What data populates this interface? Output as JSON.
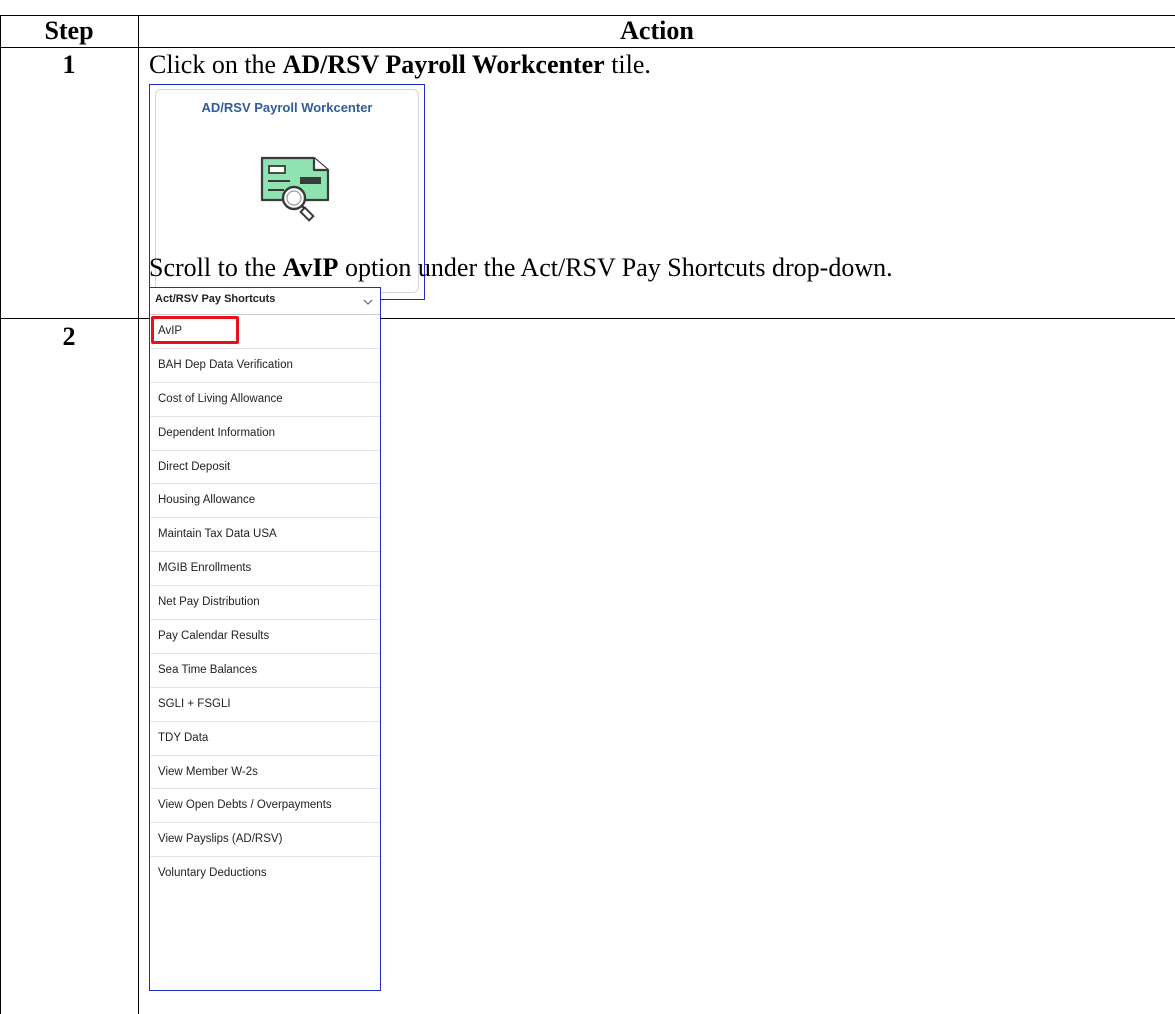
{
  "table": {
    "header_step": "Step",
    "header_action": "Action"
  },
  "steps": [
    {
      "number": "1",
      "text_before": "Click on the ",
      "text_bold": "AD/RSV Payroll Workcenter",
      "text_after": " tile."
    },
    {
      "number": "2",
      "text_before": "Scroll to the ",
      "text_bold": "AvIP",
      "text_after": " option under the Act/RSV Pay Shortcuts drop-down."
    }
  ],
  "tile": {
    "title": "AD/RSV Payroll Workcenter",
    "icon": "check-magnifier-icon",
    "icon_color": "#8fe3b0"
  },
  "dropdown": {
    "label": "Act/RSV Pay Shortcuts",
    "chevron_icon": "chevron-down-icon",
    "highlight_color": "#e8111b",
    "highlighted_item": "AvIP",
    "items": [
      "AvIP",
      "BAH Dep Data Verification",
      "Cost of Living Allowance",
      "Dependent Information",
      "Direct Deposit",
      "Housing Allowance",
      "Maintain Tax Data USA",
      "MGIB Enrollments",
      "Net Pay Distribution",
      "Pay Calendar Results",
      "Sea Time Balances",
      "SGLI + FSGLI",
      "TDY Data",
      "View Member W-2s",
      "View Open Debts / Overpayments",
      "View Payslips (AD/RSV)",
      "Voluntary Deductions"
    ]
  }
}
